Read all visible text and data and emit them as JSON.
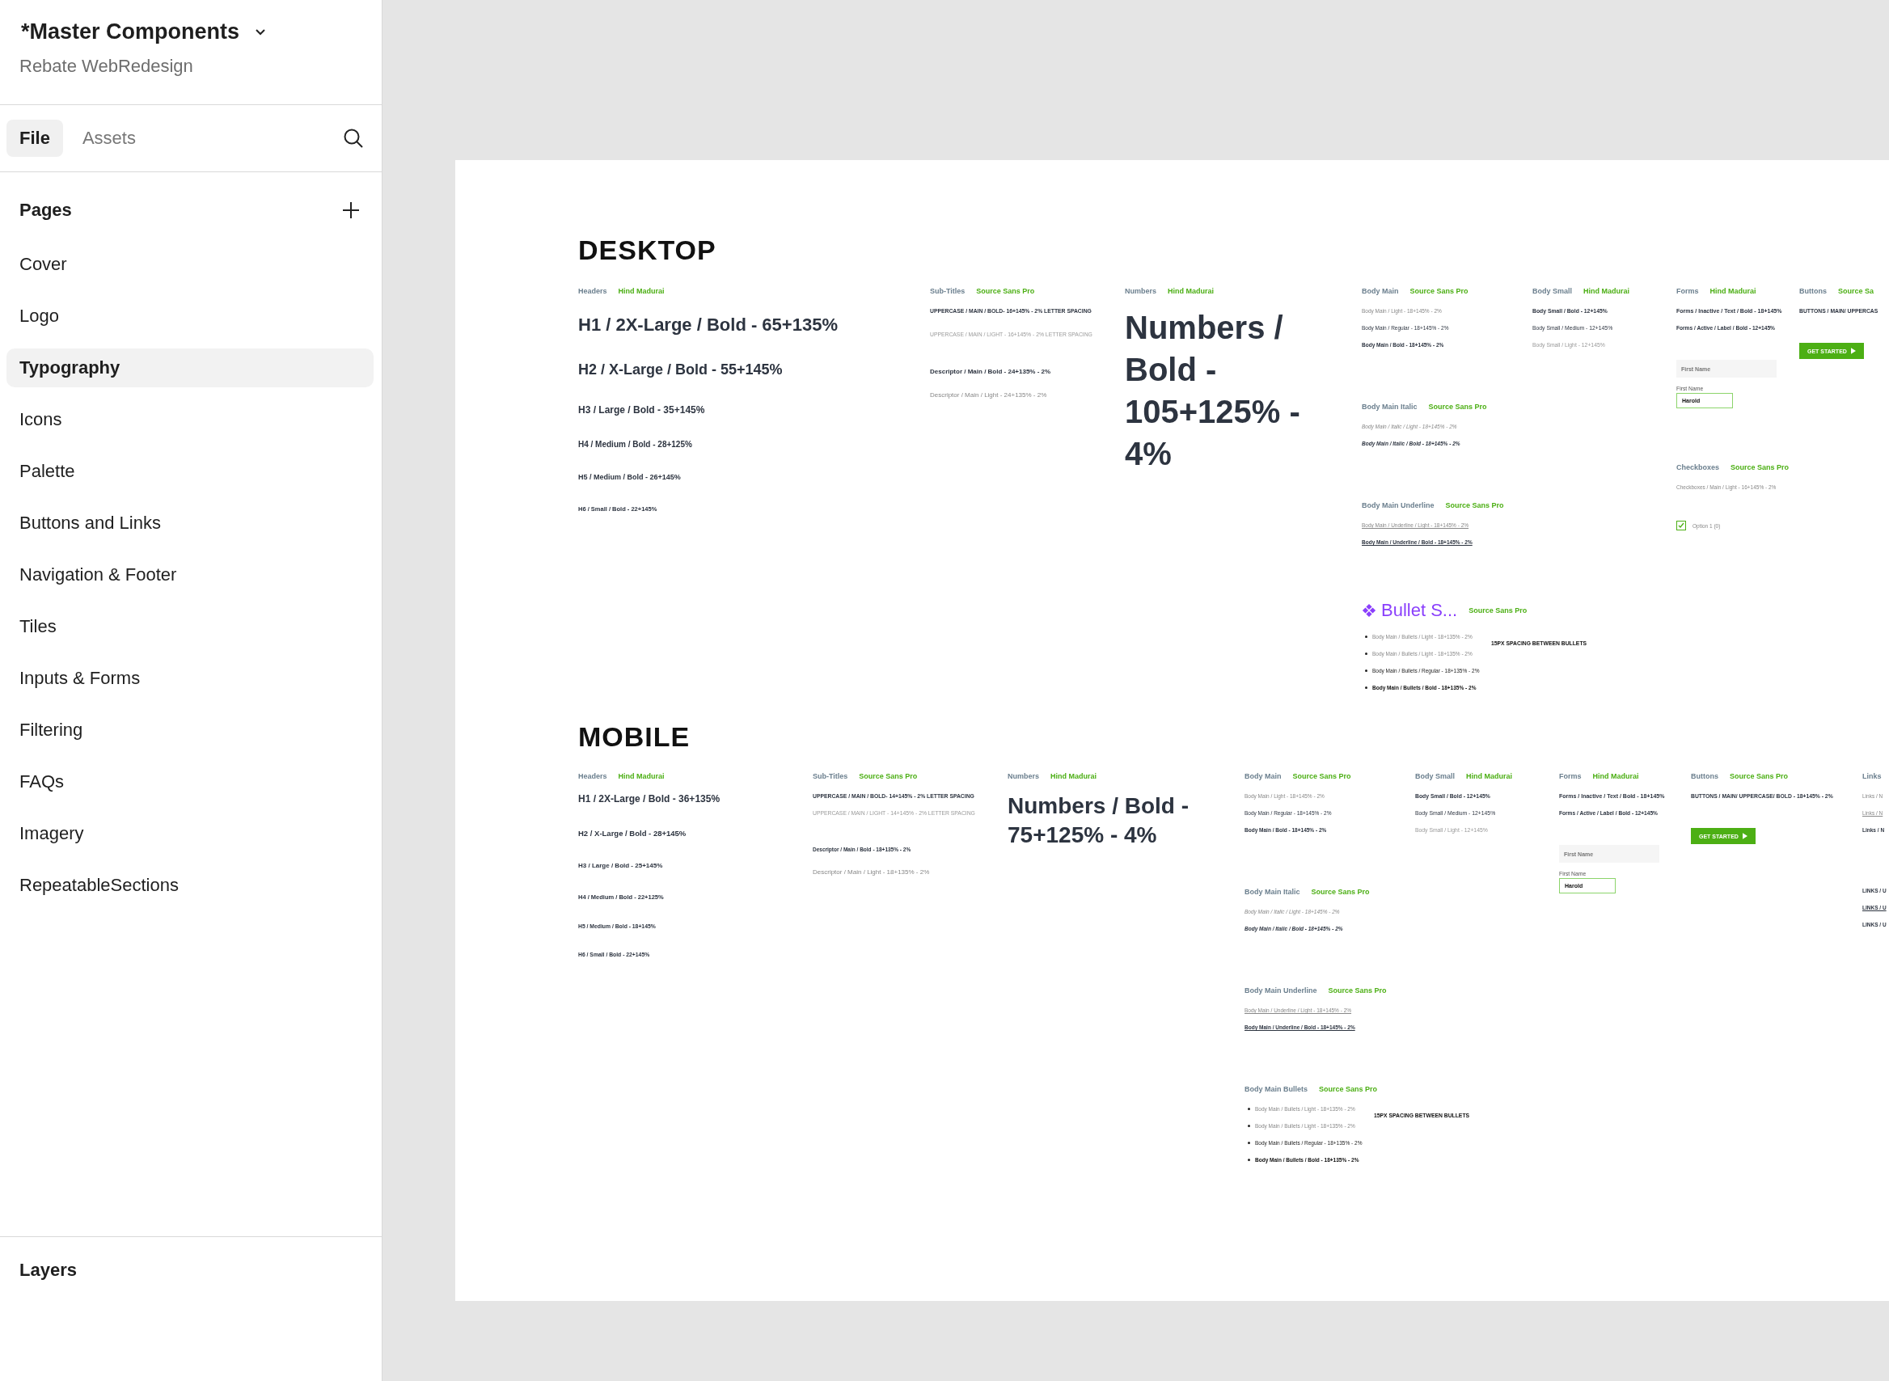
{
  "file": {
    "title": "*Master Components",
    "project": "Rebate WebRedesign"
  },
  "tabs": [
    {
      "label": "File",
      "selected": true
    },
    {
      "label": "Assets",
      "selected": false
    }
  ],
  "pages": {
    "title": "Pages",
    "items": [
      {
        "label": "Cover",
        "selected": false
      },
      {
        "label": "Logo",
        "selected": false
      },
      {
        "label": "Typography",
        "selected": true
      },
      {
        "label": "Icons",
        "selected": false
      },
      {
        "label": "Palette",
        "selected": false
      },
      {
        "label": "Buttons and Links",
        "selected": false
      },
      {
        "label": "Navigation & Footer",
        "selected": false
      },
      {
        "label": "Tiles",
        "selected": false
      },
      {
        "label": "Inputs & Forms",
        "selected": false
      },
      {
        "label": "Filtering",
        "selected": false
      },
      {
        "label": "FAQs",
        "selected": false
      },
      {
        "label": "Imagery",
        "selected": false
      },
      {
        "label": "RepeatableSections",
        "selected": false
      }
    ]
  },
  "layers": {
    "title": "Layers"
  },
  "boards": [
    {
      "kind": "desktop",
      "title": "DESKTOP",
      "columns": [
        {
          "sections": [
            {
              "label": "Headers",
              "font": "Hind Madurai",
              "items": [
                {
                  "kind": "h1",
                  "text": "H1 /  2X-Large / Bold - 65+135%"
                },
                {
                  "kind": "h2",
                  "text": "H2 / X-Large / Bold - 55+145%"
                },
                {
                  "kind": "h3",
                  "text": "H3 / Large / Bold - 35+145%"
                },
                {
                  "kind": "h4",
                  "text": "H4 / Medium / Bold - 28+125%"
                },
                {
                  "kind": "h5",
                  "text": "H5 / Medium / Bold - 26+145%"
                },
                {
                  "kind": "h6",
                  "text": "H6 / Small / Bold - 22+145%"
                }
              ]
            }
          ]
        },
        {
          "sections": [
            {
              "label": "Sub-Titles",
              "font": "Source Sans Pro",
              "items": [
                {
                  "kind": "upper-bold",
                  "text": "UPPERCASE / MAIN / BOLD- 16+145% - 2% LETTER SPACING"
                },
                {
                  "kind": "upper-light",
                  "text": "UPPERCASE / MAIN / LIGHT - 16+145% - 2% LETTER SPACING"
                },
                {
                  "kind": "desc-bold",
                  "text": "Descriptor / Main / Bold - 24+135% - 2%"
                },
                {
                  "kind": "desc-light",
                  "text": "Descriptor / Main / Light - 24+135% - 2%"
                }
              ]
            }
          ]
        },
        {
          "sections": [
            {
              "label": "Numbers",
              "font": "Hind Madurai",
              "items": [
                {
                  "kind": "numbers",
                  "text": "Numbers / Bold - 105+125% - 4%"
                }
              ]
            }
          ]
        },
        {
          "sections": [
            {
              "label": "Body Main",
              "font": "Source Sans Pro",
              "items": [
                {
                  "kind": "light",
                  "text": "Body Main / Light - 18+145% - 2%"
                },
                {
                  "kind": "regular",
                  "text": "Body Main / Regular - 18+145% - 2%"
                },
                {
                  "kind": "bold",
                  "text": "Body Main / Bold - 18+145% - 2%"
                }
              ]
            },
            {
              "label": "Body Main Italic",
              "font": "Source Sans Pro",
              "items": [
                {
                  "kind": "italic-light",
                  "text": "Body Main / Italic / Light - 18+145% - 2%"
                },
                {
                  "kind": "italic-bold",
                  "text": "Body Main / Italic / Bold - 18+145% - 2%"
                }
              ]
            },
            {
              "label": "Body Main Underline",
              "font": "Source Sans Pro",
              "items": [
                {
                  "kind": "underline-light",
                  "text": "Body Main / Underline /  Light - 18+145% - 2%"
                },
                {
                  "kind": "underline-bold",
                  "text": "Body Main / Underline / Bold - 18+145% - 2%"
                }
              ]
            },
            {
              "overlay": "Bullet S...",
              "font": "Source Sans Pro",
              "note": "15PX SPACING BETWEEN BULLETS",
              "items": [
                {
                  "kind": "bullet-light",
                  "text": "Body Main / Bullets / Light - 18+135% - 2%"
                },
                {
                  "kind": "bullet-light",
                  "text": "Body Main / Bullets / Light - 18+135% - 2%"
                },
                {
                  "kind": "bullet-regular",
                  "text": "Body Main / Bullets / Regular - 18+135% - 2%"
                },
                {
                  "kind": "bullet-bold",
                  "text": "Body Main / Bullets / Bold - 18+135% - 2%"
                }
              ]
            }
          ]
        },
        {
          "sections": [
            {
              "label": "Body Small",
              "font": "Hind Madurai",
              "items": [
                {
                  "kind": "small-bold",
                  "text": "Body Small / Bold - 12+145%"
                },
                {
                  "kind": "small-medium",
                  "text": "Body Small / Medium - 12+145%"
                },
                {
                  "kind": "small-light",
                  "text": "Body Small / Light - 12+145%"
                }
              ]
            }
          ]
        },
        {
          "sections": [
            {
              "label": "Forms",
              "font": "Hind Madurai",
              "items": [
                {
                  "kind": "forms-text",
                  "text": "Forms / Inactive / Text / Bold - 18+145%"
                },
                {
                  "kind": "forms-label",
                  "text": "Forms / Active / Label / Bold - 12+145%"
                },
                {
                  "kind": "input",
                  "placeholder": "First Name"
                },
                {
                  "kind": "input-active",
                  "label": "First Name",
                  "value": "Harold"
                }
              ]
            },
            {
              "label": "Checkboxes",
              "font": "Source Sans Pro",
              "items": [
                {
                  "kind": "light",
                  "text": "Checkboxes / Main / Light - 16+145% - 2%"
                },
                {
                  "kind": "checkbox",
                  "text": "Option 1 (0)",
                  "checked": true
                }
              ]
            }
          ]
        },
        {
          "sections": [
            {
              "label": "Buttons",
              "font": "Source Sa",
              "items": [
                {
                  "kind": "upper-bold",
                  "text": "BUTTONS / MAIN/ UPPERCAS"
                },
                {
                  "kind": "button",
                  "text": "GET STARTED"
                }
              ]
            }
          ]
        }
      ]
    },
    {
      "kind": "mobile",
      "title": "MOBILE",
      "columns": [
        {
          "sections": [
            {
              "label": "Headers",
              "font": "Hind Madurai",
              "items": [
                {
                  "kind": "h1",
                  "text": "H1 /  2X-Large / Bold - 36+135%"
                },
                {
                  "kind": "h2",
                  "text": "H2 / X-Large / Bold - 28+145%"
                },
                {
                  "kind": "h3",
                  "text": "H3 / Large / Bold - 25+145%"
                },
                {
                  "kind": "h4",
                  "text": "H4 / Medium / Bold - 22+125%"
                },
                {
                  "kind": "h5",
                  "text": "H5 / Medium / Bold - 18+145%"
                },
                {
                  "kind": "h6",
                  "text": "H6 / Small / Bold - 22+145%"
                }
              ]
            }
          ]
        },
        {
          "sections": [
            {
              "label": "Sub-Titles",
              "font": "Source Sans Pro",
              "items": [
                {
                  "kind": "upper-bold",
                  "text": "UPPERCASE / MAIN / BOLD- 14+145% - 2% LETTER SPACING"
                },
                {
                  "kind": "upper-light",
                  "text": "UPPERCASE / MAIN / LIGHT - 14+145% - 2% LETTER SPACING"
                },
                {
                  "kind": "desc-bold",
                  "text": "Descriptor / Main / Bold - 18+135% - 2%"
                },
                {
                  "kind": "desc-light",
                  "text": "Descriptor / Main / Light - 18+135% - 2%"
                }
              ]
            }
          ]
        },
        {
          "sections": [
            {
              "label": "Numbers",
              "font": "Hind Madurai",
              "items": [
                {
                  "kind": "numbers",
                  "text": "Numbers / Bold - 75+125% - 4%"
                }
              ]
            }
          ]
        },
        {
          "sections": [
            {
              "label": "Body Main",
              "font": "Source Sans Pro",
              "items": [
                {
                  "kind": "light",
                  "text": "Body Main / Light - 18+145% - 2%"
                },
                {
                  "kind": "regular",
                  "text": "Body Main / Regular - 18+145% - 2%"
                },
                {
                  "kind": "bold",
                  "text": "Body Main / Bold - 18+145% - 2%"
                }
              ]
            },
            {
              "label": "Body Main Italic",
              "font": "Source Sans Pro",
              "items": [
                {
                  "kind": "italic-light",
                  "text": "Body Main / Italic / Light - 18+145% - 2%"
                },
                {
                  "kind": "italic-bold",
                  "text": "Body Main / Italic / Bold - 18+145% - 2%"
                }
              ]
            },
            {
              "label": "Body Main Underline",
              "font": "Source Sans Pro",
              "items": [
                {
                  "kind": "underline-light",
                  "text": "Body Main / Underline /  Light - 18+145% - 2%"
                },
                {
                  "kind": "underline-bold",
                  "text": "Body Main / Underline / Bold - 18+145% - 2%"
                }
              ]
            },
            {
              "label": "Body Main Bullets",
              "font": "Source Sans Pro",
              "note": "15PX SPACING BETWEEN BULLETS",
              "items": [
                {
                  "kind": "bullet-light",
                  "text": "Body Main / Bullets / Light - 18+135% - 2%"
                },
                {
                  "kind": "bullet-light",
                  "text": "Body Main / Bullets / Light - 18+135% - 2%"
                },
                {
                  "kind": "bullet-regular",
                  "text": "Body Main / Bullets / Regular - 18+135% - 2%"
                },
                {
                  "kind": "bullet-bold",
                  "text": "Body Main / Bullets / Bold - 18+135% - 2%"
                }
              ]
            }
          ]
        },
        {
          "sections": [
            {
              "label": "Body Small",
              "font": "Hind Madurai",
              "items": [
                {
                  "kind": "small-bold",
                  "text": "Body Small / Bold - 12+145%"
                },
                {
                  "kind": "small-medium",
                  "text": "Body Small / Medium - 12+145%"
                },
                {
                  "kind": "small-light",
                  "text": "Body Small / Light - 12+145%"
                }
              ]
            }
          ]
        },
        {
          "sections": [
            {
              "label": "Forms",
              "font": "Hind Madurai",
              "items": [
                {
                  "kind": "forms-text",
                  "text": "Forms / Inactive / Text / Bold - 18+145%"
                },
                {
                  "kind": "forms-label",
                  "text": "Forms / Active / Label / Bold - 12+145%"
                },
                {
                  "kind": "input",
                  "placeholder": "First Name"
                },
                {
                  "kind": "input-active",
                  "label": "First Name",
                  "value": "Harold"
                }
              ]
            }
          ]
        },
        {
          "sections": [
            {
              "label": "Buttons",
              "font": "Source Sans Pro",
              "items": [
                {
                  "kind": "upper-bold",
                  "text": "BUTTONS / MAIN/ UPPERCASE/ BOLD - 18+145% - 2%"
                },
                {
                  "kind": "button",
                  "text": "GET STARTED"
                }
              ]
            }
          ]
        },
        {
          "sections": [
            {
              "label": "Links",
              "items": [
                {
                  "kind": "light",
                  "text": "Links / N"
                },
                {
                  "kind": "underline-light",
                  "text": "Links / N"
                },
                {
                  "kind": "bold",
                  "text": "Links / N"
                },
                {
                  "kind": "gap"
                },
                {
                  "kind": "bold",
                  "text": "LINKS / U"
                },
                {
                  "kind": "underline-bold",
                  "text": "LINKS / U"
                },
                {
                  "kind": "bold",
                  "text": "LINKS / U"
                }
              ]
            }
          ]
        }
      ]
    }
  ]
}
